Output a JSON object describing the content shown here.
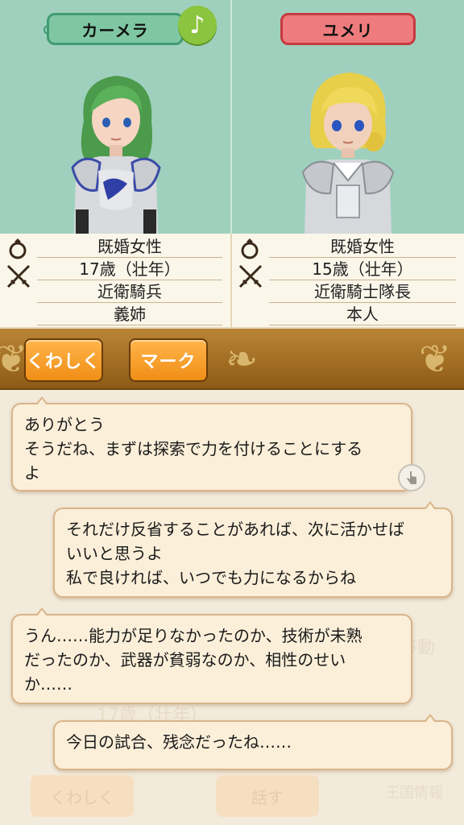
{
  "left_character": {
    "name": "カーメラ",
    "music_icon": "♪",
    "info": [
      "既婚女性",
      "17歳（壮年）",
      "近衛騎兵",
      "義姉"
    ]
  },
  "right_character": {
    "name": "ユメリ",
    "info": [
      "既婚女性",
      "15歳（壮年）",
      "近衛騎士隊長",
      "本人"
    ]
  },
  "buttons": {
    "detail": "くわしく",
    "mark": "マーク"
  },
  "messages": [
    {
      "speaker": "left",
      "lines": [
        "ありがとう",
        "そうだね、まずは探索で力を付けることにする",
        "よ"
      ]
    },
    {
      "speaker": "right",
      "lines": [
        "それだけ反省することがあれば、次に活かせば",
        "いいと思うよ",
        "私で良ければ、いつでも力になるからね"
      ]
    },
    {
      "speaker": "left",
      "lines": [
        "うん……能力が足りなかったのか、技術が未熟",
        "だったのか、武器が貧弱なのか、相性のせい",
        "か……"
      ]
    },
    {
      "speaker": "right",
      "lines": [
        "今日の試合、残念だったね……"
      ]
    }
  ],
  "background_faded": {
    "detail_button": "くわしく",
    "talk_button": "話す",
    "age_text": "17歳（壮年）",
    "move_label": "移動",
    "kingdom_info": "王国情報"
  },
  "colors": {
    "portrait_bg": "#9fd0bd",
    "left_tag": "#7fc6a3",
    "right_tag": "#ee7b7d",
    "button_orange": "#f5a02e",
    "bubble_bg": "#fbefd9"
  }
}
